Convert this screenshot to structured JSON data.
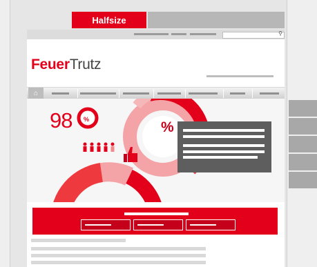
{
  "tabs": {
    "active_label": "Halfsize"
  },
  "logo": {
    "part1": "Feuer",
    "part2": "Trutz"
  },
  "hero": {
    "big_number": "98",
    "donut_symbol": "%",
    "large_symbol": "%"
  },
  "icons": {
    "search": "search-icon",
    "home": "home-icon",
    "people": "people-icon",
    "thumbs": "thumbs-up-icon"
  },
  "colors": {
    "accent": "#e2001a",
    "overlay": "#5e5e5e",
    "side": "#a8a8a8"
  }
}
